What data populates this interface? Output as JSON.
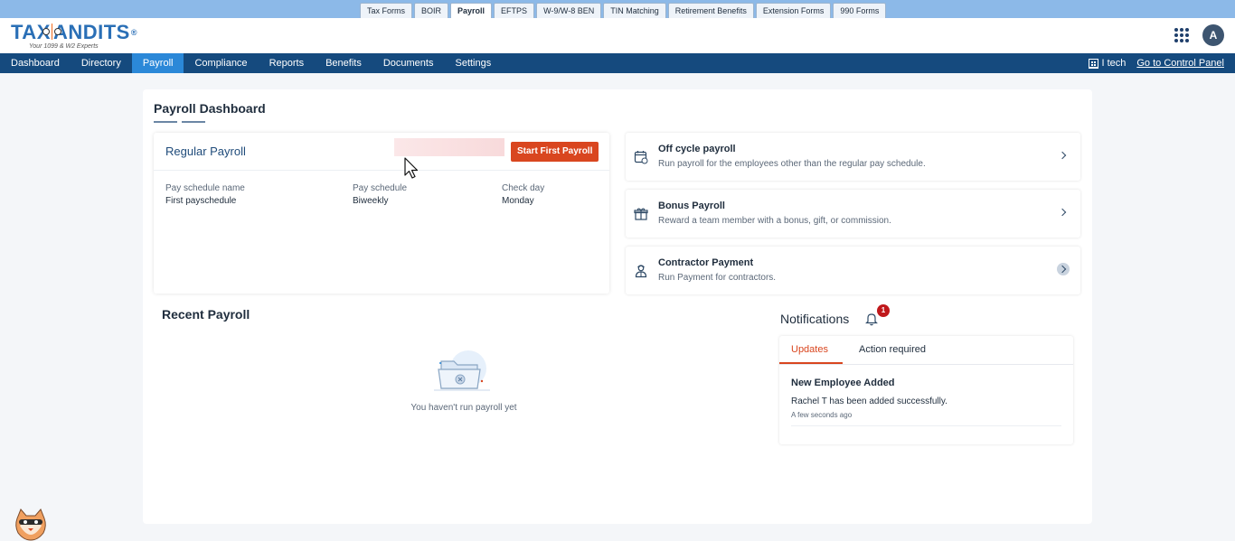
{
  "product_tabs": [
    "Tax Forms",
    "BOIR",
    "Payroll",
    "EFTPS",
    "W-9/W-8 BEN",
    "TIN Matching",
    "Retirement Benefits",
    "Extension Forms",
    "990 Forms"
  ],
  "active_product_tab": "Payroll",
  "logo": {
    "text_left": "TAX",
    "text_right": "ANDITS",
    "reg": "®",
    "tagline": "Your 1099 & W2 Experts"
  },
  "header": {
    "avatar_initial": "A"
  },
  "nav": {
    "items": [
      "Dashboard",
      "Directory",
      "Payroll",
      "Compliance",
      "Reports",
      "Benefits",
      "Documents",
      "Settings"
    ],
    "active": "Payroll",
    "company": "I tech",
    "control_panel_link": "Go to Control Panel"
  },
  "page": {
    "title": "Payroll Dashboard"
  },
  "regular_payroll": {
    "title": "Regular Payroll",
    "start_button": "Start First Payroll",
    "fields": [
      {
        "label": "Pay schedule name",
        "value": "First payschedule"
      },
      {
        "label": "Pay schedule",
        "value": "Biweekly"
      },
      {
        "label": "Check day",
        "value": "Monday"
      }
    ]
  },
  "actions": [
    {
      "title": "Off cycle payroll",
      "subtitle": "Run payroll for the employees other than the regular pay schedule.",
      "icon": "calendar-icon"
    },
    {
      "title": "Bonus Payroll",
      "subtitle": "Reward a team member with a bonus, gift, or commission.",
      "icon": "gift-icon"
    },
    {
      "title": "Contractor Payment",
      "subtitle": "Run Payment for contractors.",
      "icon": "contractor-icon"
    }
  ],
  "recent_payroll": {
    "title": "Recent Payroll",
    "empty_text": "You haven't run payroll yet"
  },
  "notifications": {
    "title": "Notifications",
    "badge_count": "1",
    "tabs": [
      "Updates",
      "Action required"
    ],
    "active_tab": "Updates",
    "items": [
      {
        "title": "New Employee Added",
        "text": "Rachel T has been added successfully.",
        "time": "A few seconds ago"
      }
    ]
  },
  "colors": {
    "nav_bg": "#154a7e",
    "nav_active": "#2b88d8",
    "accent_orange": "#d9461f",
    "badge_red": "#c0181b"
  }
}
